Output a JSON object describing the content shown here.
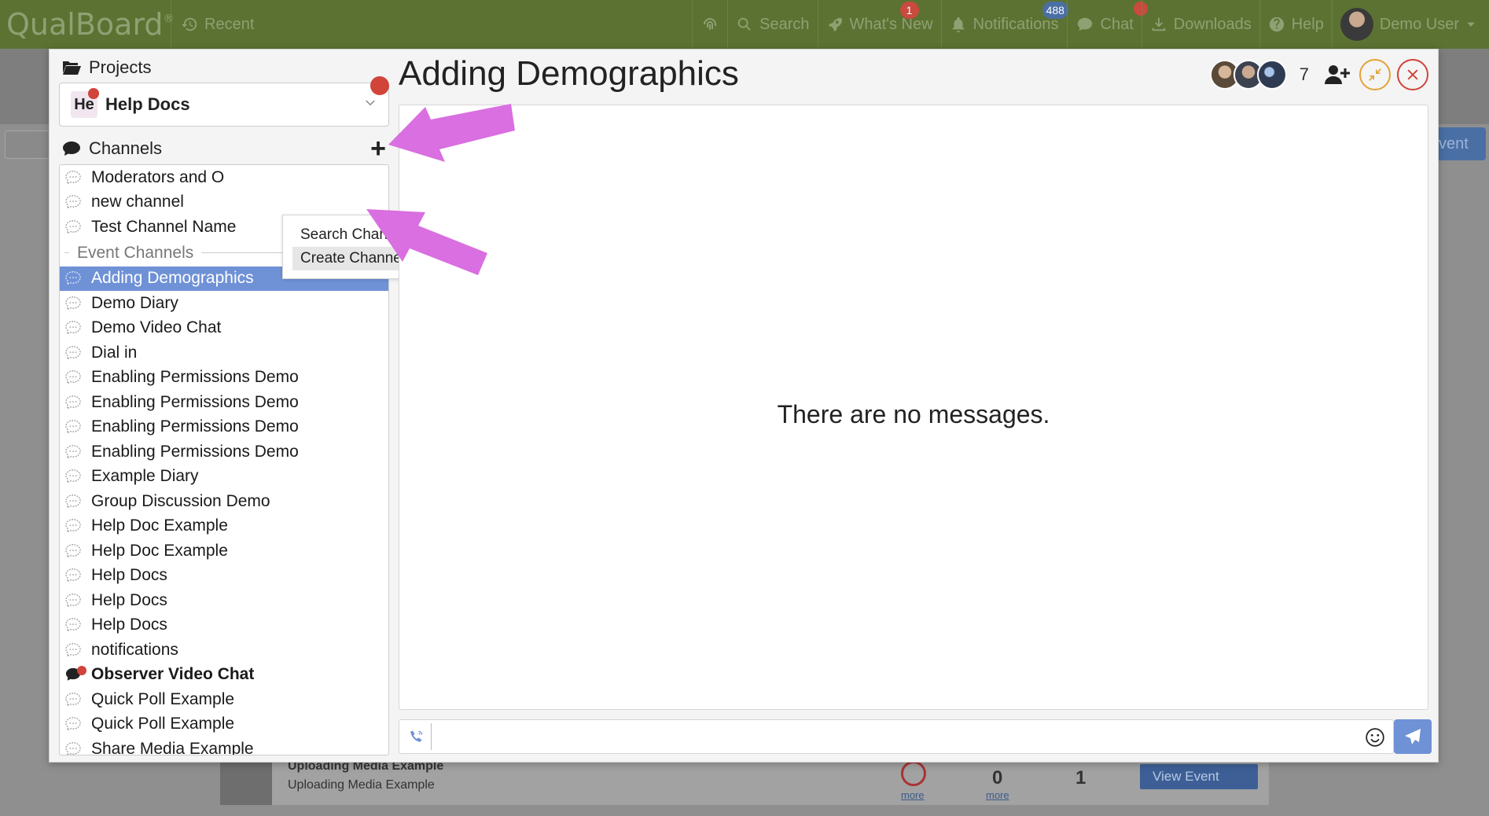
{
  "topbar": {
    "brand": "QualBoard",
    "brand_mark": "®",
    "recent_label": "Recent",
    "nav": [
      {
        "label": "",
        "icon": "fingerprint-icon"
      },
      {
        "label": "Search",
        "icon": "search-icon"
      },
      {
        "label": "What's New",
        "icon": "rocket-icon",
        "badge": "1"
      },
      {
        "label": "Notifications",
        "icon": "bell-icon",
        "badge": "488"
      },
      {
        "label": "Chat",
        "icon": "chat-icon",
        "dot": true
      },
      {
        "label": "Downloads",
        "icon": "download-icon"
      },
      {
        "label": "Help",
        "icon": "help-icon"
      }
    ],
    "user_name": "Demo User"
  },
  "background": {
    "event_button": "vent",
    "card_title": "Uploading Media Example",
    "card_subtitle": "Uploading Media Example",
    "count_0": "0",
    "count_1": "1",
    "more_1": "more",
    "more_2": "more",
    "view_event": "View Event"
  },
  "sidebar": {
    "projects_label": "Projects",
    "project_chip": "He",
    "project_name": "Help Docs",
    "channels_label": "Channels",
    "channels": [
      "Moderators and O",
      "new channel",
      "Test Channel Name"
    ],
    "event_section_label": "Event Channels",
    "event_channels": [
      {
        "label": "Adding Demographics",
        "active": true
      },
      {
        "label": "Demo Diary"
      },
      {
        "label": "Demo Video Chat"
      },
      {
        "label": "Dial in"
      },
      {
        "label": "Enabling Permissions Demo"
      },
      {
        "label": "Enabling Permissions Demo"
      },
      {
        "label": "Enabling Permissions Demo"
      },
      {
        "label": "Enabling Permissions Demo"
      },
      {
        "label": "Example Diary"
      },
      {
        "label": "Group Discussion Demo"
      },
      {
        "label": "Help Doc Example"
      },
      {
        "label": "Help Doc Example"
      },
      {
        "label": "Help Docs"
      },
      {
        "label": "Help Docs"
      },
      {
        "label": "Help Docs"
      },
      {
        "label": "notifications"
      },
      {
        "label": "Observer Video Chat",
        "bold": true,
        "unread": true
      },
      {
        "label": "Quick Poll Example"
      },
      {
        "label": "Quick Poll Example"
      },
      {
        "label": "Share Media Example"
      }
    ]
  },
  "dropdown": {
    "items": [
      "Search Channels",
      "Create Channel"
    ],
    "highlighted": "Create Channel"
  },
  "chat": {
    "title": "Adding Demographics",
    "participant_count": "7",
    "empty_message": "There are no messages.",
    "composer_value": ""
  },
  "colors": {
    "topbar": "#5c7232",
    "active_channel": "#6f91d6",
    "annotation_arrow": "#d96fe0",
    "unread_dot": "#d0443a"
  }
}
